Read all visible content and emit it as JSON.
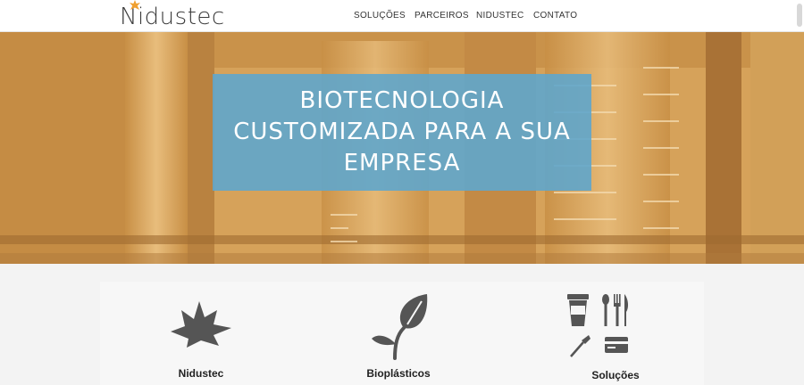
{
  "header": {
    "logo": "Nidustec",
    "nav": [
      {
        "label": "SOLUÇÕES"
      },
      {
        "label": "PARCEIROS"
      },
      {
        "label": "NIDUSTEC"
      },
      {
        "label": "CONTATO"
      }
    ]
  },
  "hero": {
    "lines": [
      "BIOTECNOLOGIA",
      "CUSTOMIZADA PARA A SUA",
      "EMPRESA"
    ]
  },
  "features": [
    {
      "label": "Nidustec",
      "icon": "nidustec-leaf-star-icon"
    },
    {
      "label": "Bioplásticos",
      "icon": "leaf-sprout-icon"
    },
    {
      "label": "Soluções",
      "icon": "solutions-icon"
    }
  ],
  "colors": {
    "hero_tint": "#d9a55a",
    "hero_box": "#5fa6cc",
    "icon_gray": "#555555",
    "logo_accent": "#f0a030"
  }
}
